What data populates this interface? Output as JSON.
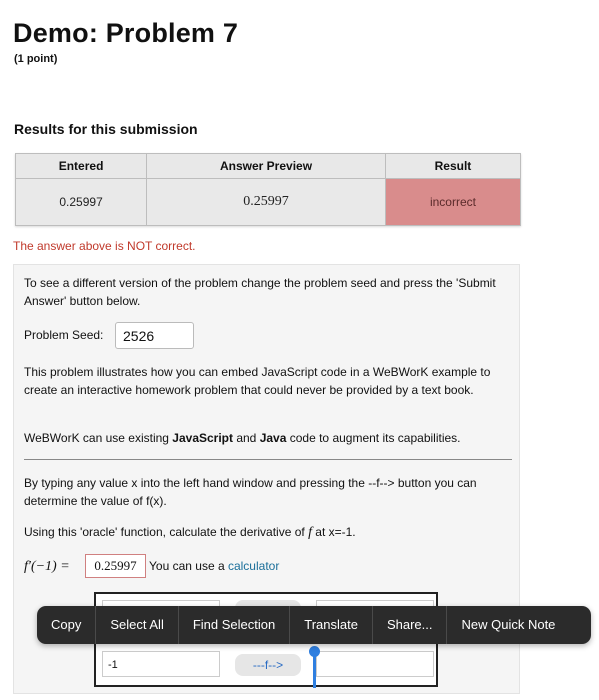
{
  "header": {
    "title": "Demo: Problem 7",
    "points": "(1 point)"
  },
  "results": {
    "heading": "Results for this submission",
    "columns": [
      "Entered",
      "Answer Preview",
      "Result"
    ],
    "row": {
      "entered": "0.25997",
      "preview": "0.25997",
      "result": "incorrect"
    },
    "message": "The answer above is NOT correct."
  },
  "problem": {
    "intro": "To see a different version of the problem change the problem seed and press the 'Submit Answer' button below.",
    "seed_label": "Problem Seed:",
    "seed_value": "2526",
    "para1": "This problem illustrates how you can embed JavaScript code in a WeBWorK example to create an interactive homework problem that could never be provided by a text book.",
    "para2_prefix": "WeBWorK can use existing ",
    "para2_js": "JavaScript",
    "para2_and": " and ",
    "para2_java": "Java",
    "para2_suffix": " code to augment its capabilities.",
    "para3": "By typing any value x into the left hand window and pressing the --f--> button you can determine the value of f(x).",
    "para4_prefix": "Using this 'oracle' function, calculate the derivative of ",
    "para4_f": "f",
    "para4_suffix": " at x=-1.",
    "fprime_label": "f′(−1) =",
    "answer_value": "0.25997",
    "calc_prefix": "You can use a ",
    "calc_link": "calculator"
  },
  "oracle": {
    "input_value": "-1",
    "button_label": "---f-->"
  },
  "context_menu": {
    "items": [
      "Copy",
      "Select All",
      "Find Selection",
      "Translate",
      "Share...",
      "New Quick Note"
    ]
  }
}
